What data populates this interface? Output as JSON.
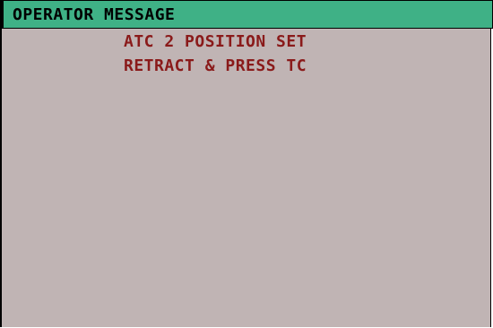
{
  "window": {
    "title": "OPERATOR MESSAGE"
  },
  "messages": [
    {
      "text": "ATC 2 POSITION SET"
    },
    {
      "text": "RETRACT & PRESS TC"
    }
  ],
  "colors": {
    "title_bar": "#3fb186",
    "panel_background": "#c0b4b4",
    "message_text": "#8a1a1a",
    "title_text": "#000000"
  }
}
